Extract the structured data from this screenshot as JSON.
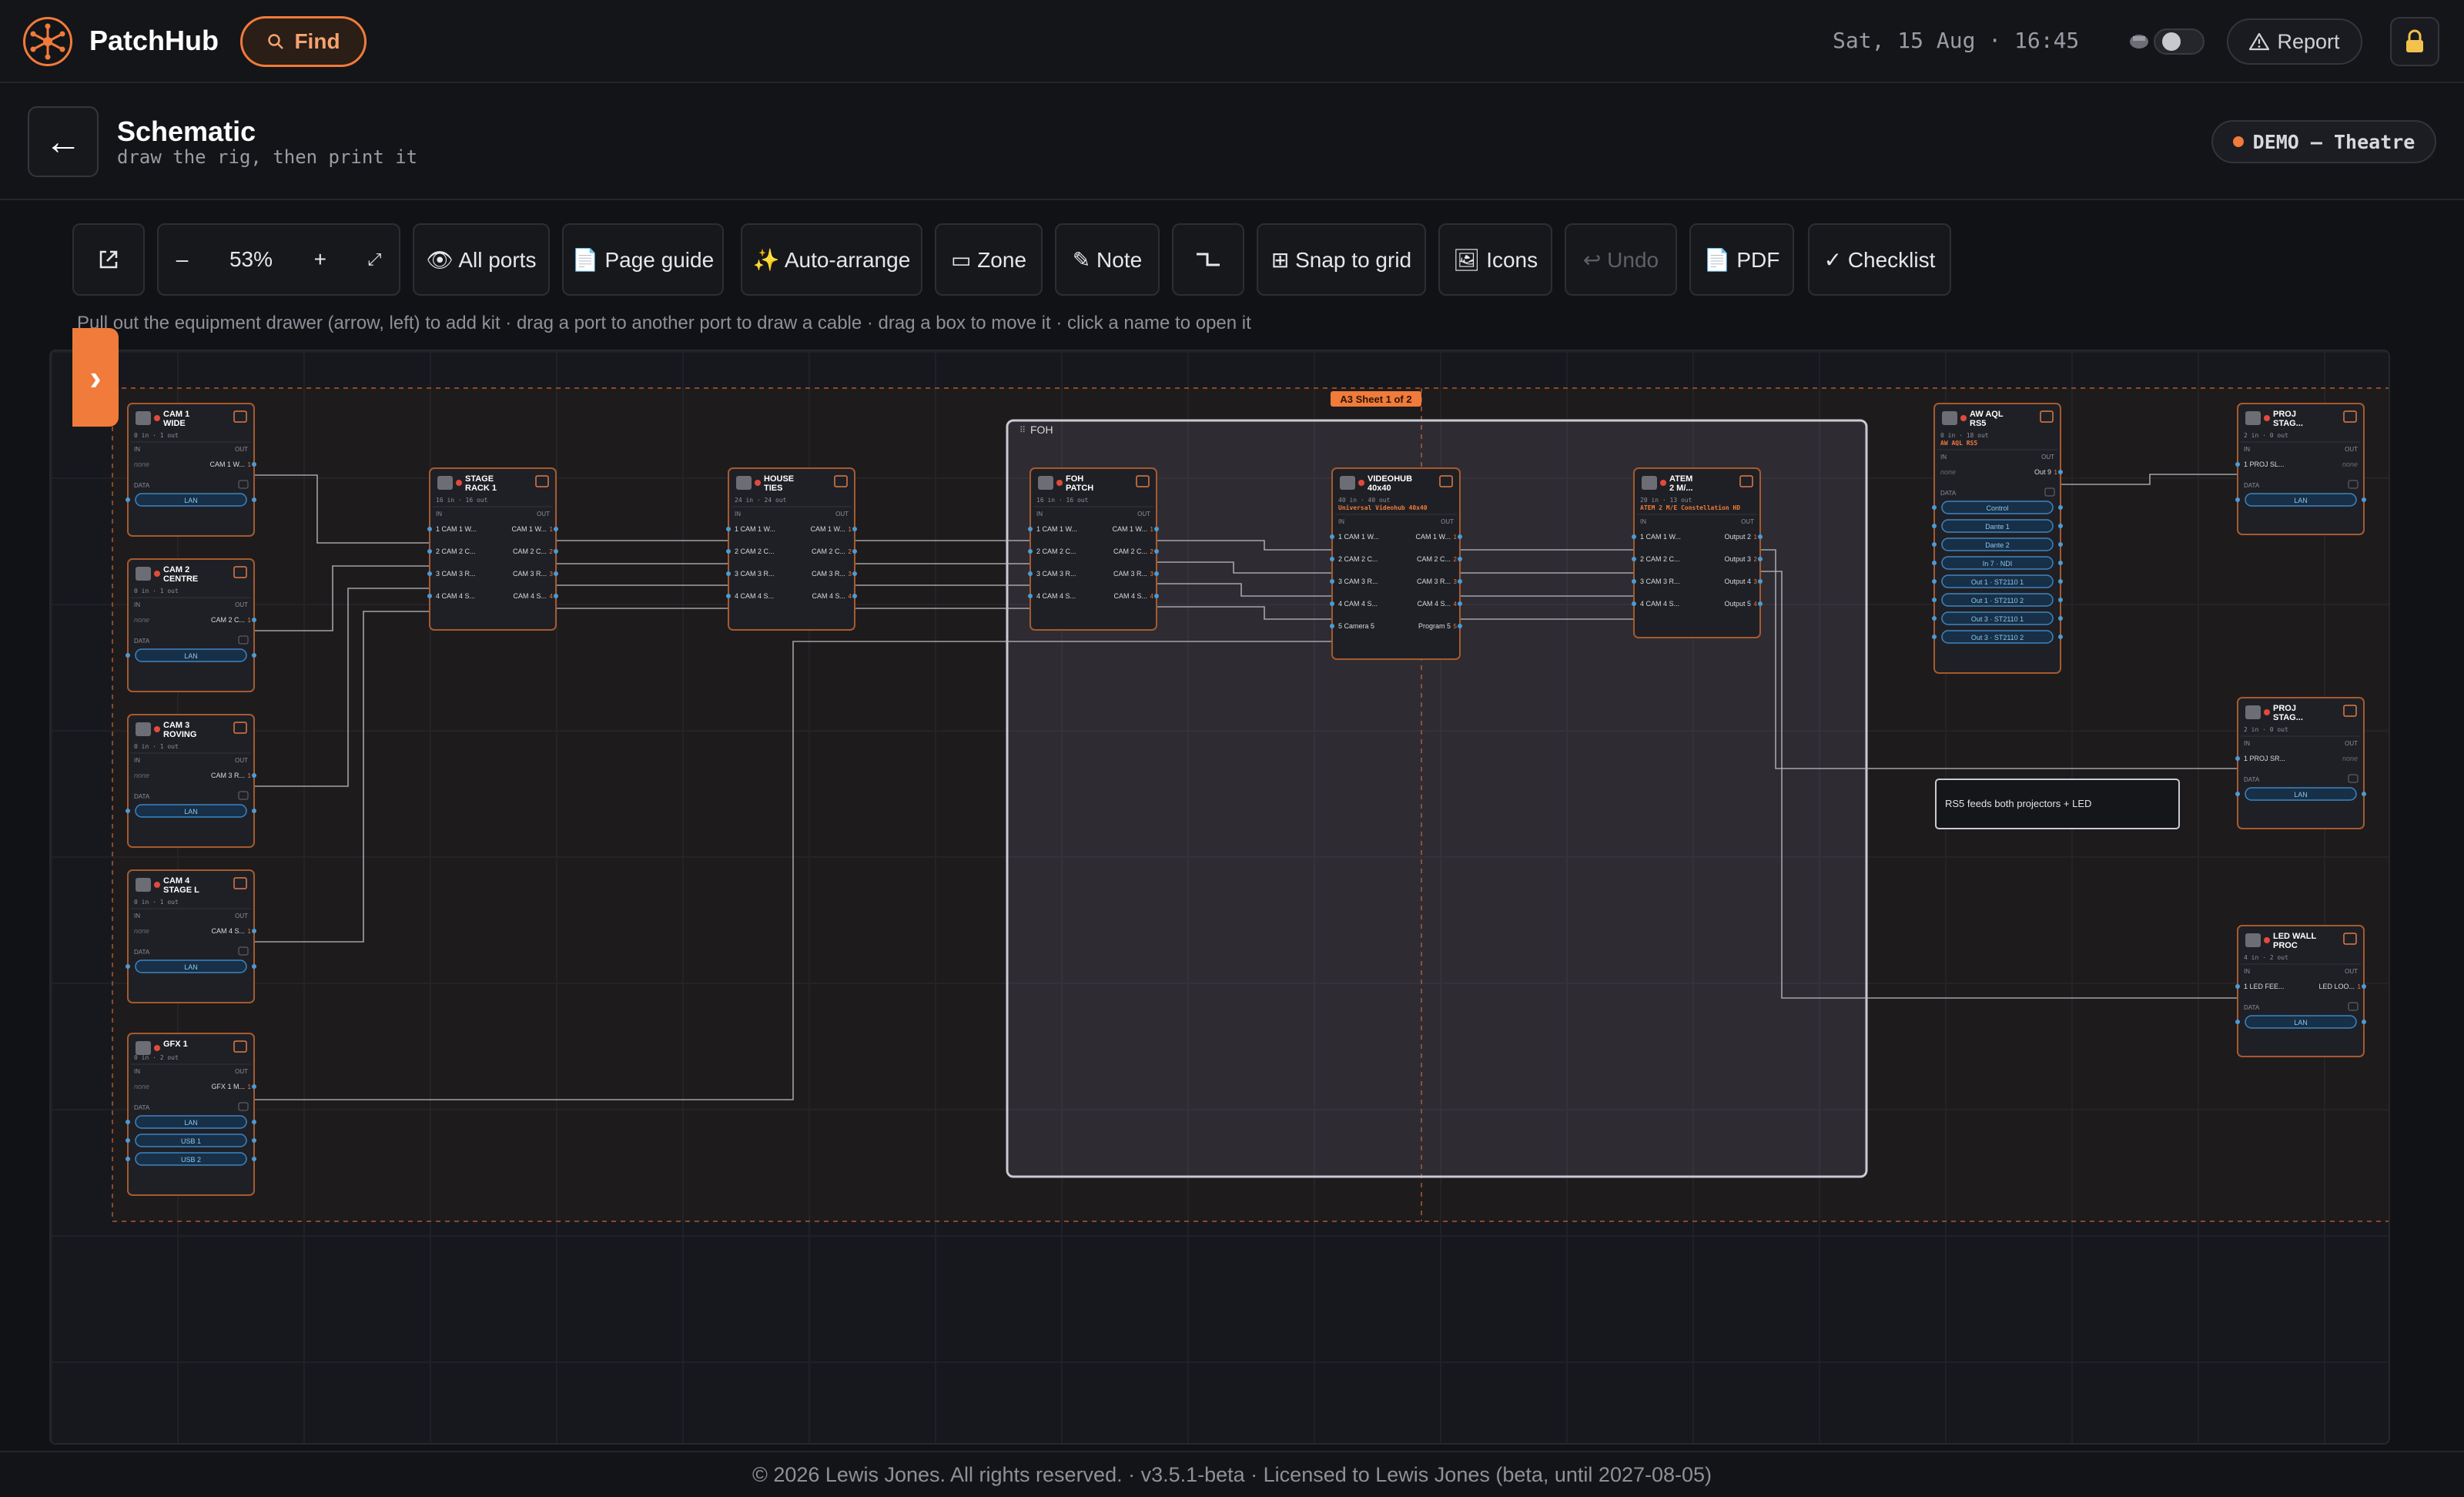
{
  "header": {
    "brand": "PatchHub",
    "find_label": "Find",
    "datetime": "Sat, 15 Aug · 16:45",
    "report_label": "Report"
  },
  "page": {
    "back_label": "←",
    "title": "Schematic",
    "subtitle": "draw the rig, then print it",
    "show_badge": "DEMO — Theatre"
  },
  "toolbar": {
    "zoom_minus": "–",
    "zoom_level": "53%",
    "zoom_plus": "+",
    "zoom_fit": "⤢",
    "all_ports": "👁 All ports",
    "page_guide": "📄 Page guide",
    "auto_arrange": "✨ Auto-arrange",
    "zone": "▭ Zone",
    "note": "✎ Note",
    "snap": "⊞ Snap to grid",
    "icons": "🖼 Icons",
    "undo": "↩ Undo",
    "pdf": "📄 PDF",
    "checklist": "✓ Checklist"
  },
  "hint": "Pull out the equipment drawer (arrow, left) to add kit · drag a port to another port to draw a cable · drag a box to move it · click a name to open it",
  "canvas": {
    "sheet_label": "A3 Sheet 1 of 2",
    "zone_label": "FOH",
    "note_text": "RS5 feeds both projectors + LED",
    "io_in": "IN",
    "io_out": "OUT",
    "io_data": "DATA",
    "port_none": "none",
    "devices": [
      {
        "name1": "CAM 1",
        "name2": "WIDE",
        "ports": "0 in · 1 out",
        "outs": [
          "CAM 1 W..."
        ],
        "data": [
          "LAN"
        ]
      },
      {
        "name1": "CAM 2",
        "name2": "CENTRE",
        "ports": "0 in · 1 out",
        "outs": [
          "CAM 2 C..."
        ],
        "data": [
          "LAN"
        ]
      },
      {
        "name1": "CAM 3",
        "name2": "ROVING",
        "ports": "0 in · 1 out",
        "outs": [
          "CAM 3 R..."
        ],
        "data": [
          "LAN"
        ]
      },
      {
        "name1": "CAM 4",
        "name2": "STAGE L",
        "ports": "0 in · 1 out",
        "outs": [
          "CAM 4 S..."
        ],
        "data": [
          "LAN"
        ]
      },
      {
        "name1": "GFX 1",
        "name2": "",
        "ports": "0 in · 2 out",
        "outs": [
          "GFX 1 M..."
        ],
        "data": [
          "LAN",
          "USB 1",
          "USB 2"
        ]
      },
      {
        "name1": "STAGE",
        "name2": "RACK 1",
        "ports": "16 in · 16 out",
        "ins": [
          "1 CAM 1 W...",
          "2 CAM 2 C...",
          "3 CAM 3 R...",
          "4 CAM 4 S..."
        ],
        "outs": [
          "CAM 1 W...",
          "CAM 2 C...",
          "CAM 3 R...",
          "CAM 4 S..."
        ]
      },
      {
        "name1": "HOUSE",
        "name2": "TIES",
        "ports": "24 in · 24 out",
        "ins": [
          "1 CAM 1 W...",
          "2 CAM 2 C...",
          "3 CAM 3 R...",
          "4 CAM 4 S..."
        ],
        "outs": [
          "CAM 1 W...",
          "CAM 2 C...",
          "CAM 3 R...",
          "CAM 4 S..."
        ]
      },
      {
        "name1": "FOH",
        "name2": "PATCH",
        "ports": "16 in · 16 out",
        "ins": [
          "1 CAM 1 W...",
          "2 CAM 2 C...",
          "3 CAM 3 R...",
          "4 CAM 4 S..."
        ],
        "outs": [
          "CAM 1 W...",
          "CAM 2 C...",
          "CAM 3 R...",
          "CAM 4 S..."
        ]
      },
      {
        "name1": "VIDEOHUB",
        "name2": "40x40",
        "ports": "40 in · 40 out",
        "model": "Universal Videohub 40x40",
        "ins": [
          "1 CAM 1 W...",
          "2 CAM 2 C...",
          "3 CAM 3 R...",
          "4 CAM 4 S...",
          "5 Camera 5"
        ],
        "outs": [
          "CAM 1 W...",
          "CAM 2 C...",
          "CAM 3 R...",
          "CAM 4 S...",
          "Program 5"
        ]
      },
      {
        "name1": "ATEM",
        "name2": "2 M/...",
        "ports": "20 in · 13 out",
        "model": "ATEM 2 M/E Constellation HD",
        "ins": [
          "1 CAM 1 W...",
          "2 CAM 2 C...",
          "3 CAM 3 R...",
          "4 CAM 4 S..."
        ],
        "outs": [
          "Output 2",
          "Output 3",
          "Output 4",
          "Output 5"
        ]
      },
      {
        "name1": "AW AQL",
        "name2": "RS5",
        "ports": "0 in · 18 out",
        "model": "AW AQL RS5",
        "outs": [
          "Out 9"
        ],
        "data": [
          "Control",
          "Dante 1",
          "Dante 2",
          "In 7 · NDI",
          "Out 1 · ST2110 1",
          "Out 1 · ST2110 2",
          "Out 3 · ST2110 1",
          "Out 3 · ST2110 2"
        ]
      },
      {
        "name1": "PROJ",
        "name2": "STAG...",
        "ports": "2 in · 0 out",
        "ins": [
          "1 PROJ SL..."
        ],
        "data": [
          "LAN"
        ]
      },
      {
        "name1": "PROJ",
        "name2": "STAG...",
        "ports": "2 in · 0 out",
        "ins": [
          "1 PROJ SR..."
        ],
        "data": [
          "LAN"
        ]
      },
      {
        "name1": "LED WALL",
        "name2": "PROC",
        "ports": "4 in · 2 out",
        "ins": [
          "1 LED FEE..."
        ],
        "outs": [
          "LED LOO..."
        ],
        "data": [
          "LAN"
        ]
      }
    ]
  },
  "footer": "© 2026 Lewis Jones. All rights reserved. · v3.5.1-beta · Licensed to Lewis Jones (beta, until 2027-08-05)",
  "colors": {
    "accent": "#f07b3a",
    "background": "#111216",
    "panel": "#1f2026",
    "cable": "#b9bac0",
    "port": "#4a9bd6"
  },
  "icons": [
    "logo-hub-icon",
    "search-icon",
    "theme-toggle-icon",
    "warning-icon",
    "lock-icon",
    "back-arrow-icon",
    "open-external-icon",
    "orthogonal-cable-icon",
    "drawer-chevron-icon"
  ]
}
